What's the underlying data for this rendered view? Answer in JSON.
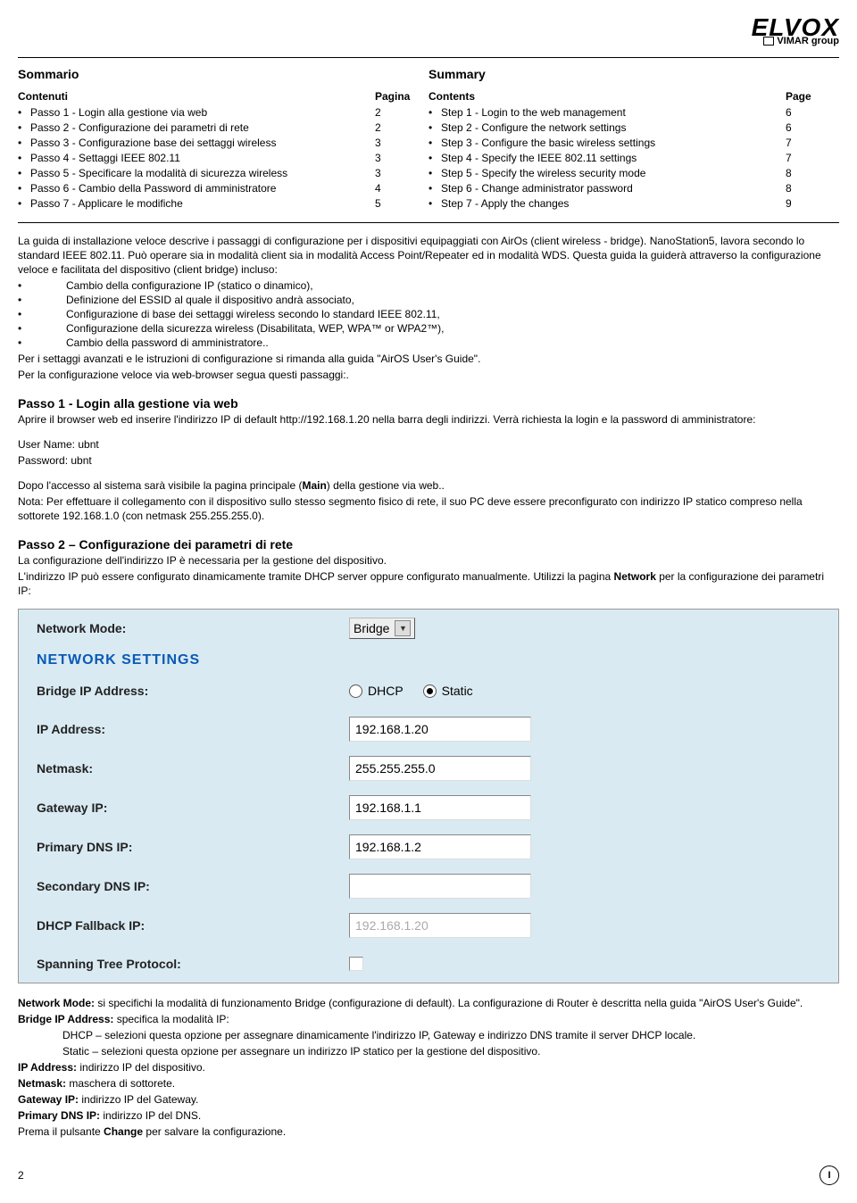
{
  "header": {
    "logo_text": "ELVOX",
    "sub_logo": "VIMAR group"
  },
  "toc": {
    "it": {
      "title": "Sommario",
      "col1_label": "Contenuti",
      "col2_label": "Pagina",
      "items": [
        {
          "text": "Passo 1 - Login alla gestione via web",
          "page": "2"
        },
        {
          "text": "Passo 2 - Configurazione dei parametri di rete",
          "page": "2"
        },
        {
          "text": "Passo 3 - Configurazione base dei settaggi wireless",
          "page": "3"
        },
        {
          "text": "Passo 4 - Settaggi IEEE 802.11",
          "page": "3"
        },
        {
          "text": "Passo 5 - Specificare la modalità di sicurezza wireless",
          "page": "3"
        },
        {
          "text": "Passo 6 - Cambio della Password di amministratore",
          "page": "4"
        },
        {
          "text": "Passo 7 - Applicare le modifiche",
          "page": "5"
        }
      ]
    },
    "en": {
      "title": "Summary",
      "col1_label": "Contents",
      "col2_label": "Page",
      "items": [
        {
          "text": "Step 1 - Login to the web management",
          "page": "6"
        },
        {
          "text": "Step 2 - Configure the network settings",
          "page": "6"
        },
        {
          "text": "Step 3 - Configure the basic wireless settings",
          "page": "7"
        },
        {
          "text": "Step 4 - Specify the IEEE 802.11 settings",
          "page": "7"
        },
        {
          "text": "Step 5 - Specify the wireless security mode",
          "page": "8"
        },
        {
          "text": "Step 6 - Change administrator password",
          "page": "8"
        },
        {
          "text": "Step 7 - Apply the changes",
          "page": "9"
        }
      ]
    }
  },
  "intro": {
    "p1": "La guida di installazione veloce descrive i passaggi di configurazione per i dispositivi equipaggiati con AirOs (client wireless - bridge). NanoStation5, lavora secondo lo standard IEEE 802.11. Può operare sia in modalità client sia in modalità Access Point/Repeater ed in modalità WDS. Questa guida la guiderà attraverso la configurazione veloce e facilitata del dispositivo (client bridge)  incluso:",
    "bullets": [
      "Cambio della configurazione IP (statico o dinamico),",
      "Definizione del ESSID al quale il dispositivo andrà associato,",
      "Configurazione di base dei settaggi wireless secondo lo standard IEEE 802.11,",
      "Configurazione della sicurezza wireless (Disabilitata, WEP, WPA™ or WPA2™),",
      "Cambio della password di amministratore.."
    ],
    "p2": "Per i settaggi avanzati e le istruzioni di configurazione si rimanda alla guida \"AirOS User's Guide\".",
    "p3": "Per la configurazione veloce via web-browser segua questi passaggi:."
  },
  "passo1": {
    "title": "Passo 1 - Login alla gestione via web",
    "p1": "Aprire il browser web ed inserire l'indirizzo IP di default http://192.168.1.20 nella barra degli indirizzi. Verrà richiesta la login e la password di amministratore:",
    "user_label": "User Name: ubnt",
    "pass_label": "Password: ubnt",
    "p2_a": "Dopo l'accesso al sistema sarà visibile la pagina principale (",
    "p2_b": "Main",
    "p2_c": ") della gestione via web..",
    "p3_a": "Nota: Per effettuare il collegamento con il dispositivo sullo stesso segmento fisico di rete, il suo PC deve essere preconfigurato con indirizzo IP statico compreso nella sottorete 192.168.1.0 (con netmask 255.255.255.0)."
  },
  "passo2": {
    "title": "Passo 2 – Configurazione dei parametri di rete",
    "p1": "La configurazione dell'indirizzo IP è necessaria per la gestione del dispositivo.",
    "p2_a": "L'indirizzo IP può essere configurato dinamicamente tramite  DHCP server oppure configurato manualmente. Utilizzi la pagina ",
    "p2_b": "Network",
    "p2_c": " per la configurazione dei parametri IP:"
  },
  "screenshot": {
    "network_mode_label": "Network Mode:",
    "network_mode_value": "Bridge",
    "section_title": "NETWORK SETTINGS",
    "fields": {
      "bridge_ip_label": "Bridge IP Address:",
      "dhcp_label": "DHCP",
      "static_label": "Static",
      "ip_label": "IP Address:",
      "ip_value": "192.168.1.20",
      "netmask_label": "Netmask:",
      "netmask_value": "255.255.255.0",
      "gateway_label": "Gateway IP:",
      "gateway_value": "192.168.1.1",
      "pdns_label": "Primary DNS IP:",
      "pdns_value": "192.168.1.2",
      "sdns_label": "Secondary DNS IP:",
      "sdns_value": "",
      "fallback_label": "DHCP Fallback IP:",
      "fallback_value": "192.168.1.20",
      "stp_label": "Spanning Tree Protocol:"
    }
  },
  "post": {
    "netmode_b": "Network Mode:",
    "netmode_t": " si specifichi la modalità di funzionamento Bridge (configurazione di default). La configurazione di Router è descritta nella guida \"AirOS User's Guide\".",
    "bip_b": "Bridge IP Address:",
    "bip_t": " specifica la modalità IP:",
    "dhcp_line": "DHCP – selezioni questa opzione per assegnare dinamicamente l'indirizzo IP, Gateway e indirizzo DNS tramite il server DHCP locale.",
    "static_line": "Static – selezioni questa opzione per assegnare un indirizzo IP statico per la gestione del dispositivo.",
    "ip_b": "IP Address:",
    "ip_t": " indirizzo IP del dispositivo.",
    "nm_b": "Netmask:",
    "nm_t": " maschera di sottorete.",
    "gw_b": "Gateway IP:",
    "gw_t": " indirizzo IP del Gateway.",
    "pdns_b": "Primary DNS IP:",
    "pdns_t": " indirizzo IP del DNS.",
    "change_a": "Prema il pulsante ",
    "change_b": "Change",
    "change_c": " per salvare la configurazione."
  },
  "footer": {
    "page_num": "2",
    "lang": "I"
  }
}
